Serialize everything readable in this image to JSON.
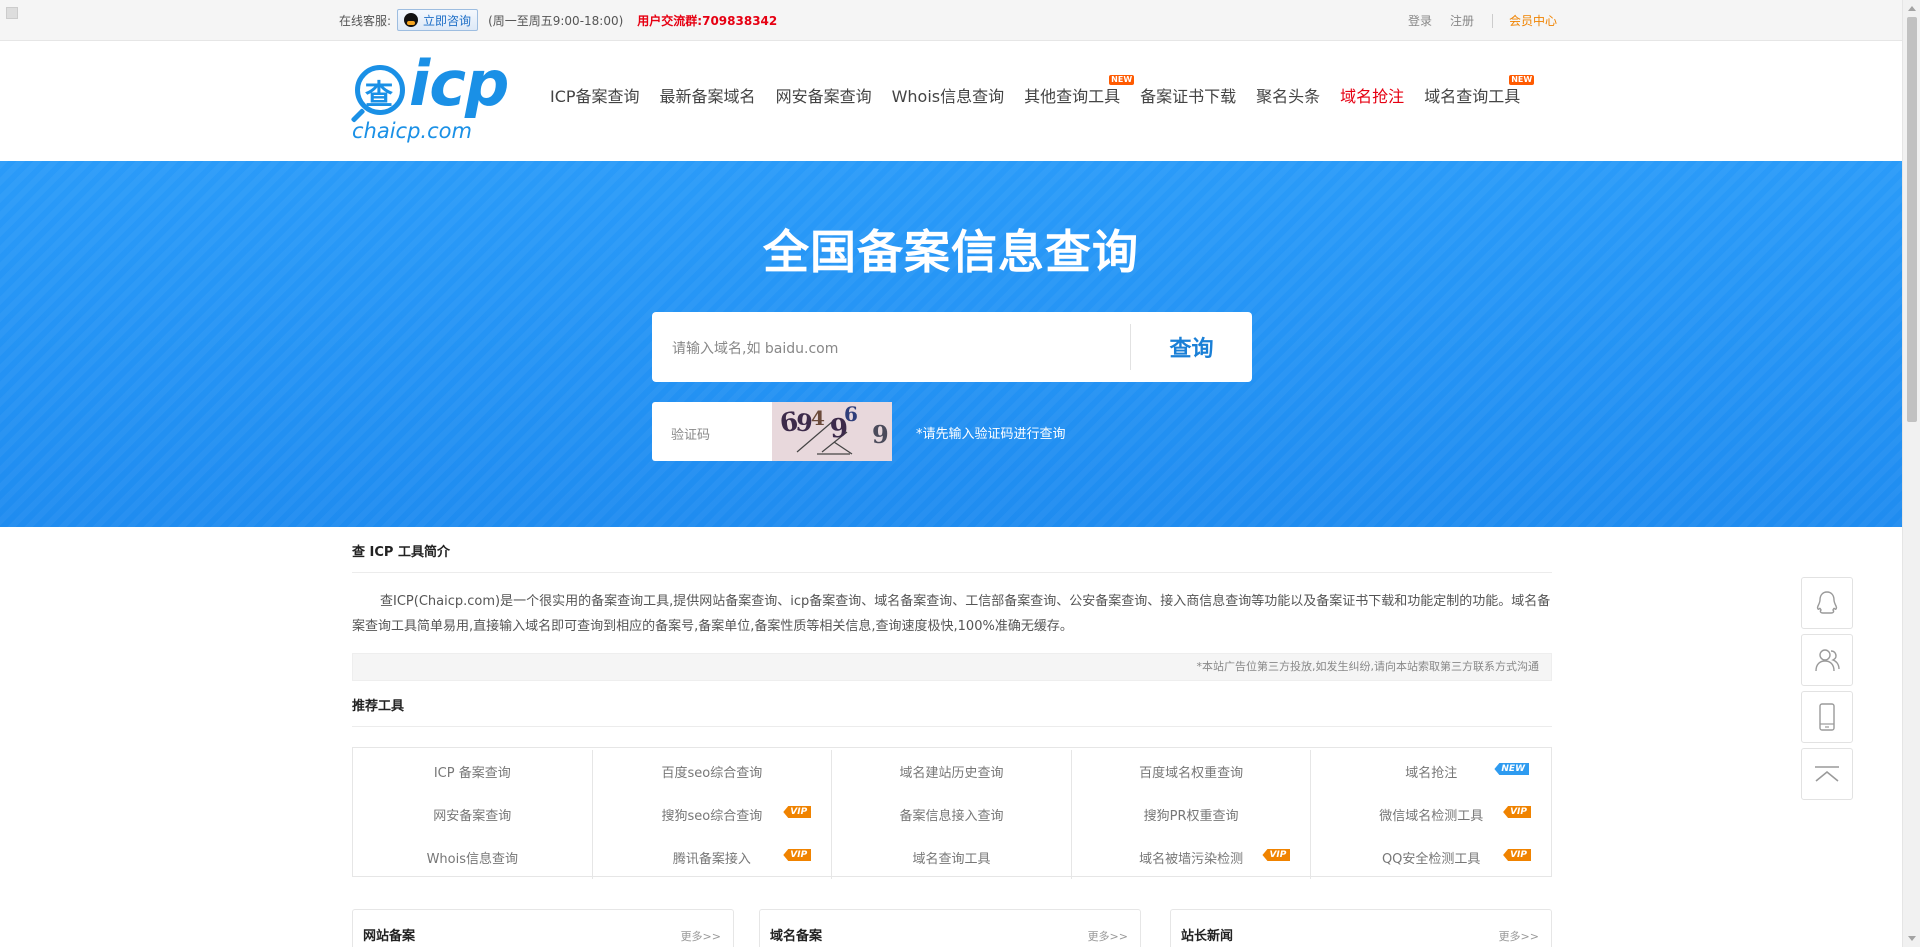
{
  "topbar": {
    "service_label": "在线客服:",
    "consult_button": "立即咨询",
    "hours": "(周一至周五9:00-18:00)",
    "group": "用户交流群:709838342",
    "login": "登录",
    "register": "注册",
    "member_center": "会员中心"
  },
  "logo": {
    "glyph": "查",
    "main": "icp",
    "sub": "chaicp.com"
  },
  "nav": {
    "items": [
      {
        "label": "ICP备案查询"
      },
      {
        "label": "最新备案域名"
      },
      {
        "label": "网安备案查询"
      },
      {
        "label": "Whois信息查询"
      },
      {
        "label": "其他查询工具",
        "badge": "NEW"
      },
      {
        "label": "备案证书下载"
      },
      {
        "label": "聚名头条"
      },
      {
        "label": "域名抢注",
        "color": "#e60012"
      },
      {
        "label": "域名查询工具",
        "badge": "NEW"
      }
    ]
  },
  "hero": {
    "title": "全国备案信息查询",
    "search_placeholder": "请输入域名,如 baidu.com",
    "search_button": "查询",
    "captcha_placeholder": "验证码",
    "captcha_text": "694969",
    "captcha_hint": "*请先输入验证码进行查询"
  },
  "intro": {
    "title": "查 ICP 工具简介",
    "text": "查ICP(Chaicp.com)是一个很实用的备案查询工具,提供网站备案查询、icp备案查询、域名备案查询、工信部备案查询、公安备案查询、接入商信息查询等功能以及备案证书下载和功能定制的功能。域名备案查询工具简单易用,直接输入域名即可查询到相应的备案号,备案单位,备案性质等相关信息,查询速度极快,100%准确无缓存。",
    "notice": "*本站广告位第三方投放,如发生纠纷,请向本站索取第三方联系方式沟通"
  },
  "tools": {
    "title": "推荐工具",
    "items": [
      {
        "label": "ICP 备案查询",
        "tag": ""
      },
      {
        "label": "百度seo综合查询",
        "tag": ""
      },
      {
        "label": "域名建站历史查询",
        "tag": ""
      },
      {
        "label": "百度域名权重查询",
        "tag": ""
      },
      {
        "label": "域名抢注",
        "tag": "NEW"
      },
      {
        "label": "网安备案查询",
        "tag": ""
      },
      {
        "label": "搜狗seo综合查询",
        "tag": "VIP"
      },
      {
        "label": "备案信息接入查询",
        "tag": ""
      },
      {
        "label": "搜狗PR权重查询",
        "tag": ""
      },
      {
        "label": "微信域名检测工具",
        "tag": "VIP"
      },
      {
        "label": "Whois信息查询",
        "tag": ""
      },
      {
        "label": "腾讯备案接入",
        "tag": "VIP"
      },
      {
        "label": "域名查询工具",
        "tag": ""
      },
      {
        "label": "域名被墙污染检测",
        "tag": "VIP"
      },
      {
        "label": "QQ安全检测工具",
        "tag": "VIP"
      }
    ]
  },
  "cards": [
    {
      "title": "网站备案",
      "more": "更多>>"
    },
    {
      "title": "域名备案",
      "more": "更多>>"
    },
    {
      "title": "站长新闻",
      "more": "更多>>"
    }
  ],
  "float_buttons": [
    {
      "icon": "qq-icon"
    },
    {
      "icon": "users-icon"
    },
    {
      "icon": "mobile-icon"
    },
    {
      "icon": "back-to-top-icon"
    }
  ],
  "colors": {
    "brand_blue": "#1a90e6",
    "hero_blue": "#2196f3",
    "accent_red": "#e60012",
    "accent_orange": "#f08300"
  }
}
